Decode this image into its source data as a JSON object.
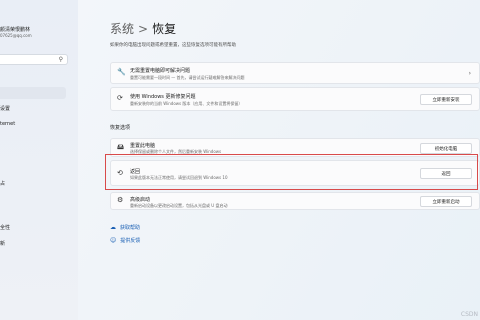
{
  "user": {
    "name": "颜清荣恨鹏林",
    "email": "07625@qq.com"
  },
  "sidebar": {
    "items": [
      {
        "label": "设置"
      },
      {
        "label": "ternet"
      },
      {
        "label": "占"
      },
      {
        "label": "全性"
      },
      {
        "label": "新"
      }
    ]
  },
  "header": {
    "parent": "系统",
    "separator": ">",
    "title": "恢复",
    "description": "如果你的电脑出现问题或希望重置，这些恢复选项可能有所帮助"
  },
  "cards": {
    "fix": {
      "title": "无需重置电脑即可解决问题",
      "subtitle": "重置可能需要一段时间 — 首先，请尝试运行疑难解答来解决问题"
    },
    "windows_update": {
      "title": "使用 Windows 更新修复问题",
      "subtitle": "重新安装你的当前 Windows 版本（应用、文件和设置将保留）",
      "button": "立即重新安装"
    }
  },
  "recovery_section": {
    "title": "恢复选项",
    "reset": {
      "title": "重置此电脑",
      "subtitle": "选择保留或删除个人文件，然后重新安装 Windows",
      "button": "初始化电脑"
    },
    "go_back": {
      "title": "返回",
      "subtitle": "如果此版本无法正常使用，请尝试回退到 Windows 10",
      "button": "返回"
    },
    "advanced": {
      "title": "高级启动",
      "subtitle": "重新启动设备以更改启动设置，包括从光盘或 U 盘启动",
      "button": "立即重新启动"
    }
  },
  "links": {
    "help": "获取帮助",
    "feedback": "提供反馈"
  },
  "icons": {
    "search": "search-icon",
    "wrench": "wrench-icon",
    "refresh": "refresh-icon",
    "reset": "reset-pc-icon",
    "history": "history-icon",
    "advanced": "advanced-startup-icon",
    "help": "help-icon",
    "feedback": "feedback-icon"
  },
  "colors": {
    "accent": "#1a5fb4",
    "highlight": "#d84a4a"
  },
  "watermark": "CSDN"
}
